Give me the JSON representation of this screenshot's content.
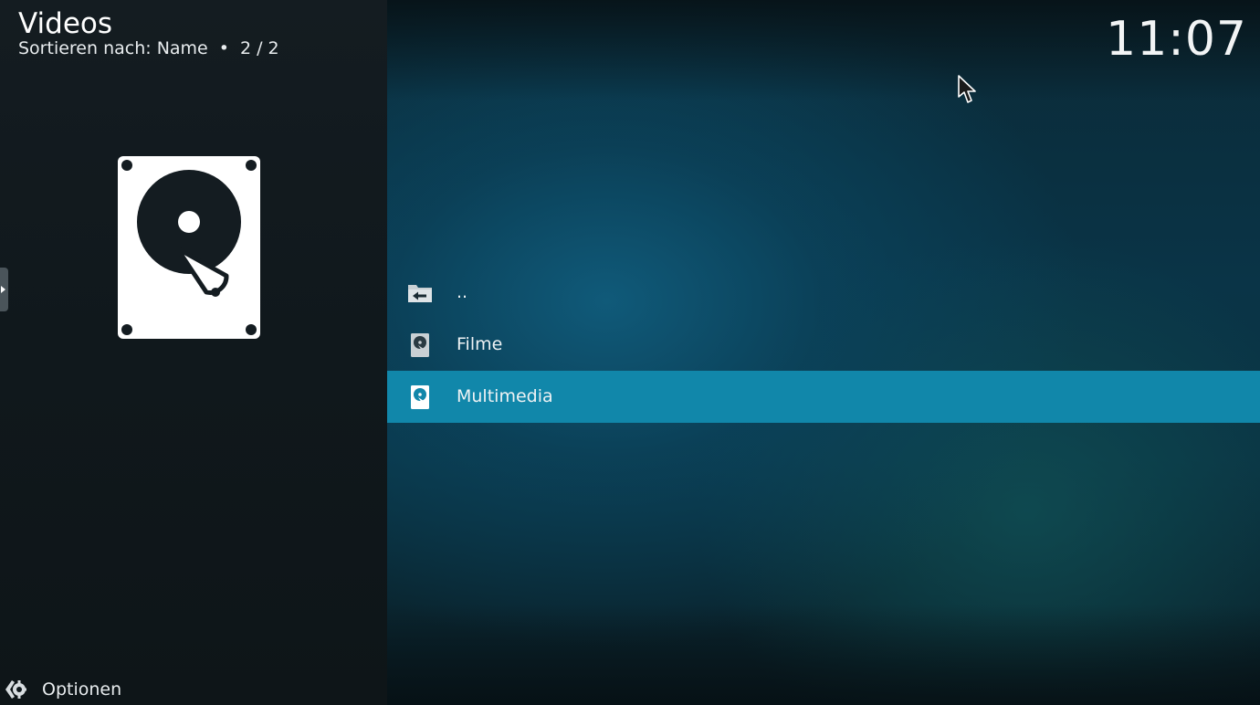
{
  "header": {
    "title": "Videos",
    "sort_label": "Sortieren nach: Name",
    "separator": "•",
    "page_counter": "2 / 2"
  },
  "clock": {
    "time": "11:07"
  },
  "list": {
    "items": [
      {
        "label": "..",
        "icon": "folder-back-icon",
        "selected": false
      },
      {
        "label": "Filme",
        "icon": "hard-drive-icon",
        "selected": false
      },
      {
        "label": "Multimedia",
        "icon": "hard-drive-icon",
        "selected": true
      }
    ]
  },
  "preview": {
    "icon": "hard-drive-icon"
  },
  "footer": {
    "options_label": "Optionen",
    "icon": "settings-gear-icon"
  },
  "colors": {
    "selected_row": "#1187aa",
    "left_panel": "#141c21",
    "text": "#ffffff"
  }
}
